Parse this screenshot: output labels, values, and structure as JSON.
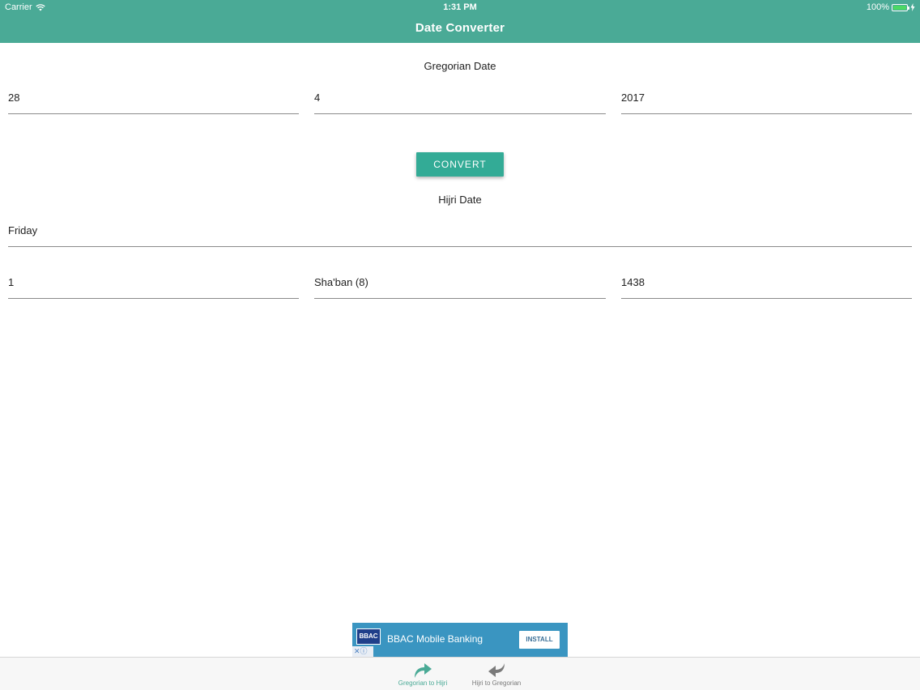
{
  "status_bar": {
    "carrier": "Carrier",
    "time": "1:31 PM",
    "battery": "100%"
  },
  "nav": {
    "title": "Date Converter"
  },
  "gregorian": {
    "label": "Gregorian Date",
    "day": "28",
    "month": "4",
    "year": "2017"
  },
  "convert_label": "CONVERT",
  "hijri": {
    "label": "Hijri Date",
    "weekday": "Friday",
    "day": "1",
    "month": "Sha'ban (8)",
    "year": "1438"
  },
  "ad": {
    "logo_text": "BBAC",
    "title": "BBAC Mobile Banking",
    "install_label": "INSTALL"
  },
  "tabs": [
    {
      "label": "Gregorian to Hijri",
      "icon": "redo-arrow-icon",
      "active": true
    },
    {
      "label": "Hijri to Gregorian",
      "icon": "undo-arrow-icon",
      "active": false
    }
  ],
  "colors": {
    "primary": "#4aaa96",
    "button": "#33ab96",
    "ad_background": "#3a95c1",
    "battery_fill": "#4cd964"
  }
}
